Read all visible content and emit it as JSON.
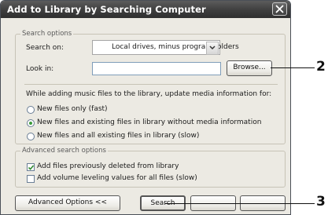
{
  "dialog": {
    "title": "Add to Library by Searching Computer"
  },
  "search_options": {
    "legend": "Search options",
    "search_on_label": "Search on:",
    "search_on_value": "Local drives, minus program folders",
    "look_in_label": "Look in:",
    "look_in_value": "",
    "browse_label": "Browse...",
    "update_prompt": "While adding music files to the library, update media information for:",
    "radios": [
      {
        "label": "New files only (fast)",
        "selected": false
      },
      {
        "label": "New files and existing files in library without media information",
        "selected": true
      },
      {
        "label": "New files and all existing files in library (slow)",
        "selected": false
      }
    ]
  },
  "advanced": {
    "legend": "Advanced search options",
    "checkboxes": [
      {
        "label": "Add files previously deleted from library",
        "checked": true
      },
      {
        "label": "Add volume leveling values for all files (slow)",
        "checked": false
      }
    ]
  },
  "buttons": {
    "advanced_label": "Advanced Options <<",
    "search_label": "Search"
  },
  "callouts": {
    "browse_number": "2",
    "search_number": "3"
  }
}
